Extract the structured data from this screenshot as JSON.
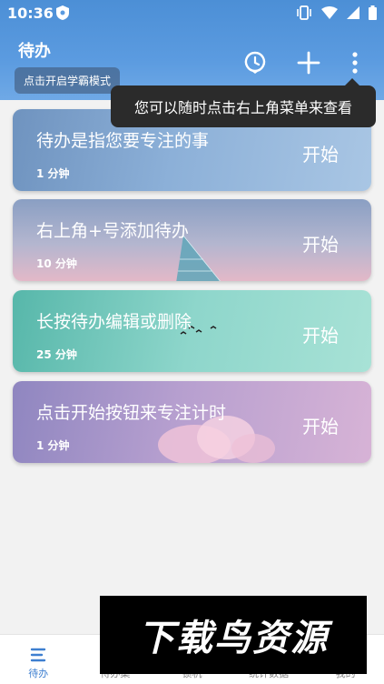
{
  "status_bar": {
    "time": "10:36"
  },
  "header": {
    "title": "待办",
    "mode_button": "点击开启学霸模式",
    "icons": [
      "clock-icon",
      "plus-icon",
      "more-vert-icon"
    ]
  },
  "tooltip": {
    "text": "您可以随时点击右上角菜单来查看"
  },
  "todos": [
    {
      "title": "待办是指您要专注的事",
      "duration": "1 分钟",
      "start": "开始"
    },
    {
      "title": "右上角+号添加待办",
      "duration": "10 分钟",
      "start": "开始"
    },
    {
      "title": "长按待办编辑或删除",
      "duration": "25 分钟",
      "start": "开始"
    },
    {
      "title": "点击开始按钮来专注计时",
      "duration": "1 分钟",
      "start": "开始"
    }
  ],
  "tabs": [
    {
      "label": "待办",
      "active": true
    },
    {
      "label": "待办集"
    },
    {
      "label": "锁机"
    },
    {
      "label": "统计数据"
    },
    {
      "label": "我的"
    }
  ],
  "watermark": {
    "text": "下载鸟资源"
  },
  "colors": {
    "accent": "#3e7fd0",
    "header": "#5b9be0"
  }
}
